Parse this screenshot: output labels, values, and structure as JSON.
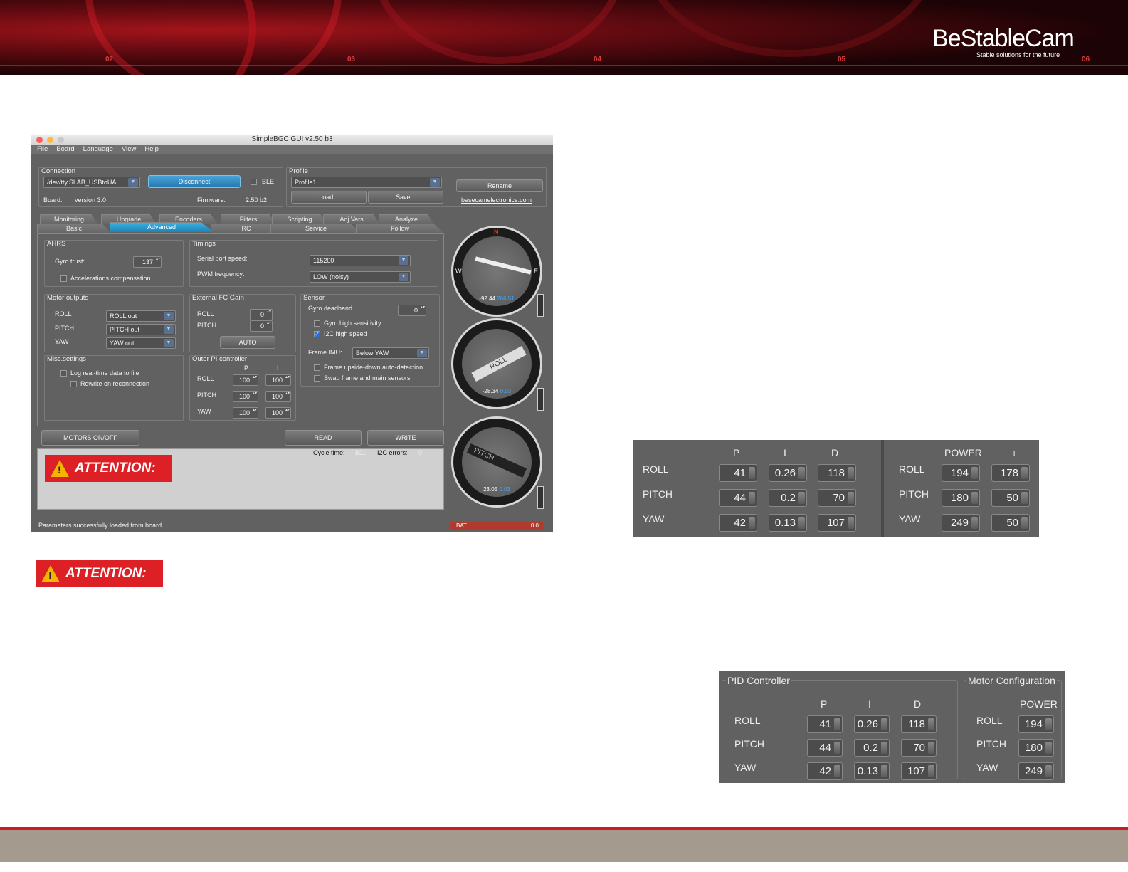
{
  "banner": {
    "logo": "BeStableCam",
    "tagline": "Stable solutions for the future",
    "markers": [
      "02",
      "03",
      "04",
      "05",
      "06"
    ]
  },
  "window": {
    "title": "SimpleBGC GUI v2.50 b3",
    "menu": [
      "File",
      "Board",
      "Language",
      "View",
      "Help"
    ],
    "connection": {
      "group": "Connection",
      "port": "/dev/tty.SLAB_USBtoUA...",
      "disconnect": "Disconnect",
      "ble": "BLE",
      "board_label": "Board:",
      "board_value": "version 3.0",
      "firmware_label": "Firmware:",
      "firmware_value": "2.50 b2"
    },
    "profile": {
      "group": "Profile",
      "selected": "Profile1",
      "load": "Load...",
      "save": "Save...",
      "rename": "Rename",
      "link": "basecamelectronics.com"
    },
    "tabs_top": [
      "Monitoring",
      "Upgrade",
      "Encoders",
      "Filters",
      "Scripting",
      "Adj.Vars",
      "Analyze"
    ],
    "tabs_bottom": [
      "Basic",
      "Advanced",
      "RC",
      "Service",
      "Follow"
    ],
    "ahrs": {
      "group": "AHRS",
      "gyro_trust_label": "Gyro trust:",
      "gyro_trust": "137",
      "acc_comp": "Accelerations compensation"
    },
    "timings": {
      "group": "Timings",
      "serial_label": "Serial port speed:",
      "serial_value": "115200",
      "pwm_label": "PWM frequency:",
      "pwm_value": "LOW (noisy)"
    },
    "motor_outputs": {
      "group": "Motor outputs",
      "roll": "ROLL",
      "pitch": "PITCH",
      "yaw": "YAW",
      "roll_val": "ROLL out",
      "pitch_val": "PITCH out",
      "yaw_val": "YAW out"
    },
    "ext_fc": {
      "group": "External FC Gain",
      "roll": "ROLL",
      "pitch": "PITCH",
      "roll_val": "0",
      "pitch_val": "0",
      "auto": "AUTO"
    },
    "sensor": {
      "group": "Sensor",
      "deadband_label": "Gyro deadband",
      "deadband": "0",
      "gyro_high": "Gyro high sensitivity",
      "i2c": "I2C high speed",
      "frame_imu_label": "Frame IMU:",
      "frame_imu": "Below YAW",
      "upside": "Frame upside-down auto-detection",
      "swap": "Swap frame and main sensors"
    },
    "misc": {
      "group": "Misc.settings",
      "log": "Log real-time data to file",
      "rewrite": "Rewrite on reconnection"
    },
    "outer_pi": {
      "group": "Outer PI controller",
      "p": "P",
      "i": "I",
      "roll": "ROLL",
      "pitch": "PITCH",
      "yaw": "YAW",
      "roll_p": "100",
      "roll_i": "100",
      "pitch_p": "100",
      "pitch_i": "100",
      "yaw_p": "100",
      "yaw_i": "100"
    },
    "motors_btn": "MOTORS ON/OFF",
    "read_btn": "READ",
    "write_btn": "WRITE",
    "cycle_label": "Cycle time:",
    "cycle_value": "801",
    "i2c_label": "I2C errors:",
    "i2c_value": "0",
    "attention": "ATTENTION:",
    "status": "Parameters successfully loaded from board.",
    "bat_label": "BAT",
    "bat_value": "0.0",
    "gauges": [
      {
        "name": "yaw",
        "a": "-92.44",
        "b": "266.51",
        "n": "N",
        "w": "W",
        "e": "E"
      },
      {
        "name": "roll",
        "label": "ROLL",
        "a": "-28.34",
        "b": "0.03"
      },
      {
        "name": "pitch",
        "label": "PITCH",
        "a": "23.05",
        "b": "0.03"
      }
    ]
  },
  "attention_page": "ATTENTION:",
  "pid_table": {
    "headers": [
      "P",
      "I",
      "D",
      "POWER",
      "+"
    ],
    "rows": [
      {
        "axis": "ROLL",
        "p": "41",
        "i": "0.26",
        "d": "118",
        "power": "194",
        "plus": "178"
      },
      {
        "axis": "PITCH",
        "p": "44",
        "i": "0.2",
        "d": "70",
        "power": "180",
        "plus": "50"
      },
      {
        "axis": "YAW",
        "p": "42",
        "i": "0.13",
        "d": "107",
        "power": "249",
        "plus": "50"
      }
    ]
  },
  "pid_panel": {
    "pid_title": "PID Controller",
    "motor_title": "Motor Configuration",
    "headers": [
      "P",
      "I",
      "D",
      "POWER"
    ],
    "rows": [
      {
        "axis": "ROLL",
        "p": "41",
        "i": "0.26",
        "d": "118",
        "power": "194"
      },
      {
        "axis": "PITCH",
        "p": "44",
        "i": "0.2",
        "d": "70",
        "power": "180"
      },
      {
        "axis": "YAW",
        "p": "42",
        "i": "0.13",
        "d": "107",
        "power": "249"
      }
    ]
  },
  "colors": {
    "accent_red": "#d01a21",
    "footer": "#a59a8e",
    "tab_active": "#2a9bd0",
    "panel_gray": "#616161"
  }
}
